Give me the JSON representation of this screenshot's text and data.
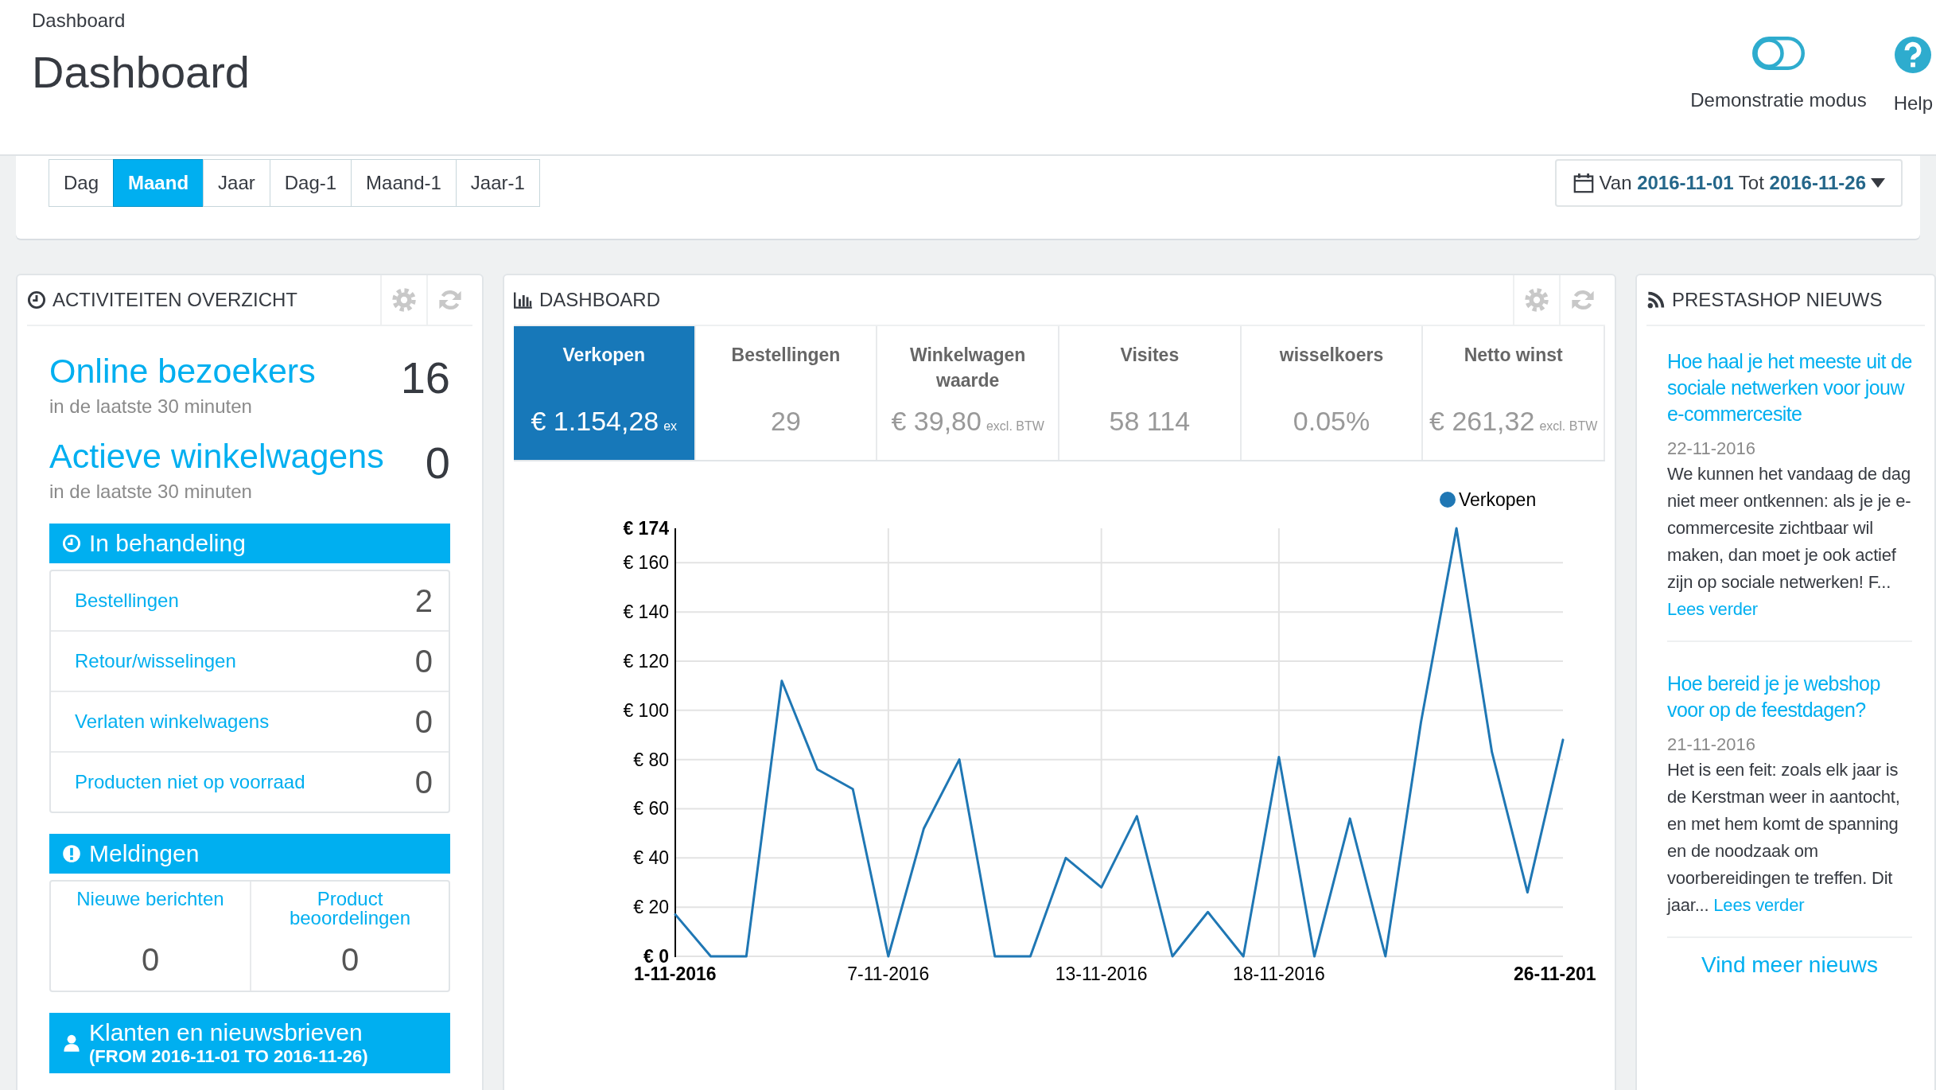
{
  "breadcrumb": "Dashboard",
  "page_title": "Dashboard",
  "header_actions": [
    {
      "kind": "toggle",
      "label": "Demonstratie modus",
      "on": false
    },
    {
      "kind": "help",
      "label": "Help"
    }
  ],
  "period_buttons": [
    {
      "label": "Dag",
      "selected": false
    },
    {
      "label": "Maand",
      "selected": true
    },
    {
      "label": "Jaar",
      "selected": false
    },
    {
      "label": "Dag-1",
      "selected": false
    },
    {
      "label": "Maand-1",
      "selected": false
    },
    {
      "label": "Jaar-1",
      "selected": false
    }
  ],
  "date_range": "Van **2016-11-01** Tot **2016-11-26**",
  "activity": {
    "title": "ACTIVITEITEN OVERZICHT",
    "metrics": [
      {
        "label": "Online bezoekers",
        "value": "16",
        "note": "in de laatste 30 minuten"
      },
      {
        "label": "Actieve winkelwagens",
        "value": "0",
        "note": "in de laatste 30 minuten"
      }
    ],
    "sections": [
      {
        "kind": "list",
        "title": "In behandeling",
        "rows": [
          {
            "label": "Bestellingen",
            "value": "2"
          },
          {
            "label": "Retour/wisselingen",
            "value": "0"
          },
          {
            "label": "Verlaten winkelwagens",
            "value": "0"
          },
          {
            "label": "Producten niet op voorraad",
            "value": "0"
          }
        ]
      },
      {
        "kind": "columns",
        "title": "Meldingen",
        "cells": [
          {
            "label": "Nieuwe berichten",
            "value": "0"
          },
          {
            "label": "Product beoordelingen",
            "value": "0"
          }
        ]
      },
      {
        "kind": "banner",
        "title": "Klanten en nieuwsbrieven",
        "subtitle": "(FROM 2016-11-01 TO 2016-11-26)"
      }
    ]
  },
  "dashboard": {
    "title": "DASHBOARD",
    "kpis": [
      {
        "label": "Verkopen",
        "value": "€ 1.154,28",
        "suffix": "ex",
        "selected": true
      },
      {
        "label": "Bestellingen",
        "value": "29",
        "selected": false
      },
      {
        "label": "Winkelwagen waarde",
        "value": "€ 39,80",
        "suffix": "excl. BTW",
        "selected": false
      },
      {
        "label": "Visites",
        "value": "58 114",
        "selected": false
      },
      {
        "label": "wisselkoers",
        "value": "0.05%",
        "selected": false
      },
      {
        "label": "Netto winst",
        "value": "€ 261,32",
        "suffix": "excl. BTW",
        "selected": false
      }
    ],
    "chart_data": {
      "type": "line",
      "categories": [
        "1-11-2016",
        null,
        null,
        null,
        null,
        null,
        "7-11-2016",
        null,
        null,
        null,
        null,
        null,
        "13-11-2016",
        null,
        null,
        null,
        null,
        "18-11-2016",
        null,
        null,
        null,
        null,
        null,
        null,
        null,
        "26-11-201"
      ],
      "series": [
        {
          "name": "Verkopen",
          "color": "#1f77b4",
          "values": [
            17,
            0,
            0,
            112,
            76,
            68,
            0,
            52,
            80,
            0,
            0,
            40,
            28,
            57,
            0,
            18,
            0,
            81,
            0,
            56,
            0,
            95,
            174,
            83,
            26,
            88
          ]
        }
      ],
      "ylim": [
        0,
        174
      ],
      "grid": true,
      "yticks": [
        {
          "value": 0,
          "label": "€ 0"
        },
        {
          "value": 20,
          "label": "€ 20"
        },
        {
          "value": 40,
          "label": "€ 40"
        },
        {
          "value": 60,
          "label": "€ 60"
        },
        {
          "value": 80,
          "label": "€ 80"
        },
        {
          "value": 100,
          "label": "€ 100"
        },
        {
          "value": 120,
          "label": "€ 120"
        },
        {
          "value": 140,
          "label": "€ 140"
        },
        {
          "value": 160,
          "label": "€ 160"
        },
        {
          "value": 174,
          "label": "€ 174"
        }
      ]
    }
  },
  "news": {
    "title": "PRESTASHOP NIEUWS",
    "items": [
      {
        "title": "Hoe haal je het meeste uit de sociale netwerken voor jouw e-commercesite",
        "date": "22-11-2016",
        "excerpt": "We kunnen het vandaag de dag niet meer ontkennen: als je je e-commercesite zichtbaar wil maken, dan moet je ook actief zijn op sociale netwerken! F...",
        "link": "Lees verder"
      },
      {
        "title": "Hoe bereid je je webshop voor op de feestdagen?",
        "date": "21-11-2016",
        "excerpt": "Het is een feit: zoals elk jaar is de Kerstman weer in aantocht, en met hem komt de spanning en de noodzaak om voorbereidingen te treffen. Dit jaar...",
        "link": "Lees verder"
      }
    ],
    "more": "Vind meer nieuws"
  }
}
